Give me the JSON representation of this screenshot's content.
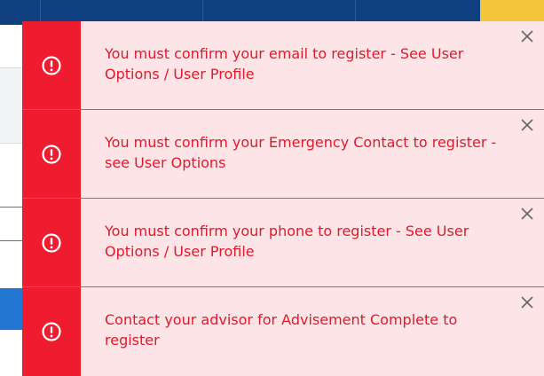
{
  "colors": {
    "topbar": "#0f3f7e",
    "topbar_accent": "#f4c43a",
    "toast_background": "#fde5e7",
    "toast_icon_column": "#ee1c2e",
    "toast_text": "#e0182b"
  },
  "notifications": [
    {
      "icon": "alert-circle-icon",
      "message": "You must confirm your email to register - See User Options / User Profile",
      "close_icon": "close-icon"
    },
    {
      "icon": "alert-circle-icon",
      "message": "You must confirm your Emergency Contact to register - see User Options",
      "close_icon": "close-icon"
    },
    {
      "icon": "alert-circle-icon",
      "message": "You must confirm your phone to register - See User Options / User Profile",
      "close_icon": "close-icon"
    },
    {
      "icon": "alert-circle-icon",
      "message": "Contact your advisor for Advisement Complete to register",
      "close_icon": "close-icon"
    }
  ]
}
